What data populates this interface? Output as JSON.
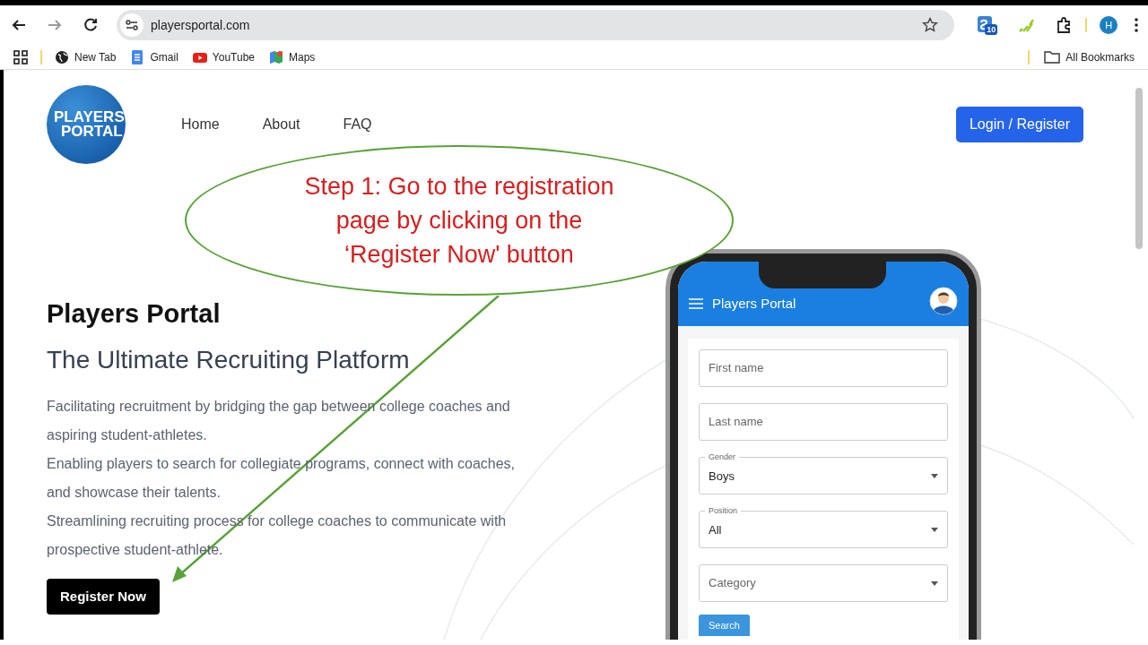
{
  "browser": {
    "url": "playersportal.com",
    "extension_badge": "10",
    "profile_initial": "H",
    "bookmarks": [
      {
        "label": "New Tab",
        "kind": "globe"
      },
      {
        "label": "Gmail",
        "kind": "doc"
      },
      {
        "label": "YouTube",
        "kind": "video"
      },
      {
        "label": "Maps",
        "kind": "map"
      }
    ],
    "all_bookmarks": "All Bookmarks"
  },
  "site": {
    "logo": [
      "PLAYERS",
      "PORTAL"
    ],
    "nav": [
      {
        "label": "Home"
      },
      {
        "label": "About"
      },
      {
        "label": "FAQ"
      }
    ],
    "login_button": "Login / Register",
    "hero_title": "Players Portal",
    "hero_subtitle": "The Ultimate Recruiting Platform",
    "paragraphs": [
      "Facilitating recruitment by bridging the gap between college coaches and aspiring student-athletes.",
      "Enabling players to search for collegiate programs, connect with coaches, and showcase their talents.",
      "Streamlining recruiting process for college coaches to communicate with prospective student-athlete."
    ],
    "register_button": "Register Now"
  },
  "phone": {
    "app_title": "Players Portal",
    "fields": [
      {
        "kind": "text",
        "placeholder": "First name"
      },
      {
        "kind": "text",
        "placeholder": "Last name"
      },
      {
        "kind": "select",
        "label": "Gender",
        "value": "Boys"
      },
      {
        "kind": "select",
        "label": "Position",
        "value": "All"
      },
      {
        "kind": "select",
        "placeholder": "Category"
      }
    ],
    "search_button": "Search"
  },
  "callout": {
    "lines": [
      "Step 1: Go to the registration",
      "page by clicking on the",
      "‘Register Now' button"
    ]
  }
}
